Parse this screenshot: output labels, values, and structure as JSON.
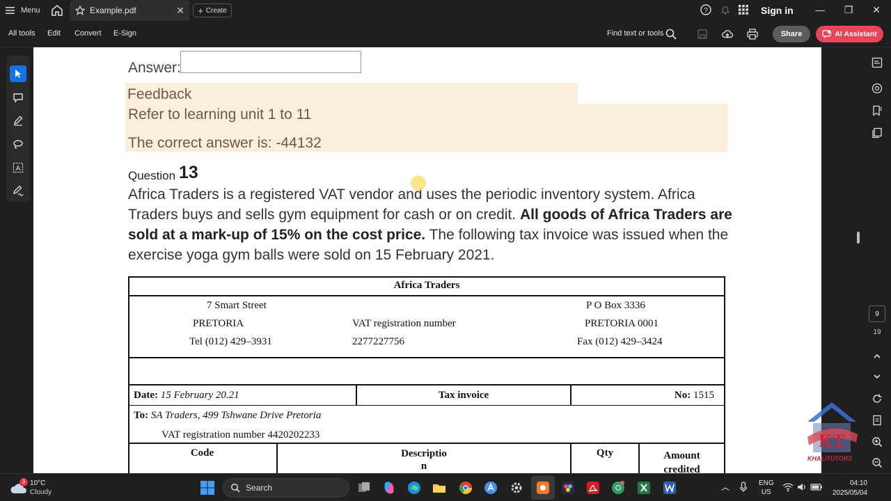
{
  "titlebar": {
    "menu_label": "Menu",
    "tab_title": "Example.pdf",
    "create_label": "Create",
    "sign_in": "Sign in"
  },
  "toolbar": {
    "all_tools": "All tools",
    "edit": "Edit",
    "convert": "Convert",
    "esign": "E-Sign",
    "find_placeholder": "Find text or tools",
    "share": "Share",
    "ai_assistant": "AI Assistant"
  },
  "pager": {
    "current": "9",
    "total": "19"
  },
  "document": {
    "answer_label": "Answer:",
    "answer_value": "",
    "feedback_title": "Feedback",
    "feedback_line1": "Refer to learning unit 1 to 11",
    "feedback_line2": "The correct answer is: -44132",
    "question_label": "Question",
    "question_number": "13",
    "question_text_1": "Africa Traders is a registered VAT vendor and uses the periodic inventory system. Africa Traders buys and sells gym equipment for cash or on credit. ",
    "question_text_bold": "All goods of Africa Traders are sold at a mark-up of 15% on the cost price.",
    "question_text_2": " The following tax invoice was issued when the exercise yoga gym balls were sold on 15 February 2021."
  },
  "invoice": {
    "company": "Africa Traders",
    "street": "7 Smart Street",
    "city": "PRETORIA",
    "tel": "Tel (012) 429–3931",
    "vat_label": "VAT registration number",
    "vat_number": "2277227756",
    "po_box": "P O Box 3336",
    "po_city": "PRETORIA 0001",
    "fax": "Fax (012) 429–3424",
    "date_label": "Date:",
    "date_value": "15 February 20.21",
    "doc_type": "Tax invoice",
    "no_label": "No:",
    "no_value": "1515",
    "to_label": "To:",
    "to_value": "SA Traders, 499 Tshwane Drive Pretoria",
    "customer_vat": "VAT registration number 4420202233",
    "col_code": "Code",
    "col_desc_1": "Descriptio",
    "col_desc_2": "n",
    "col_qty": "Qty",
    "col_amount_1": "Amount",
    "col_amount_2": "credited"
  },
  "taskbar": {
    "weather_badge": "3",
    "temp": "10°C",
    "condition": "Cloudy",
    "search": "Search",
    "lang_1": "ENG",
    "lang_2": "US",
    "time": "04:10",
    "date": "2025/05/04"
  },
  "watermark": {
    "initials": "KT",
    "brand": "KHALITUTORS"
  },
  "colors": {
    "ai_button": "#e6455b",
    "active_tool": "#1473e6",
    "feedback_bg": "#fbeedd",
    "feedback_text": "#6b5a43"
  }
}
